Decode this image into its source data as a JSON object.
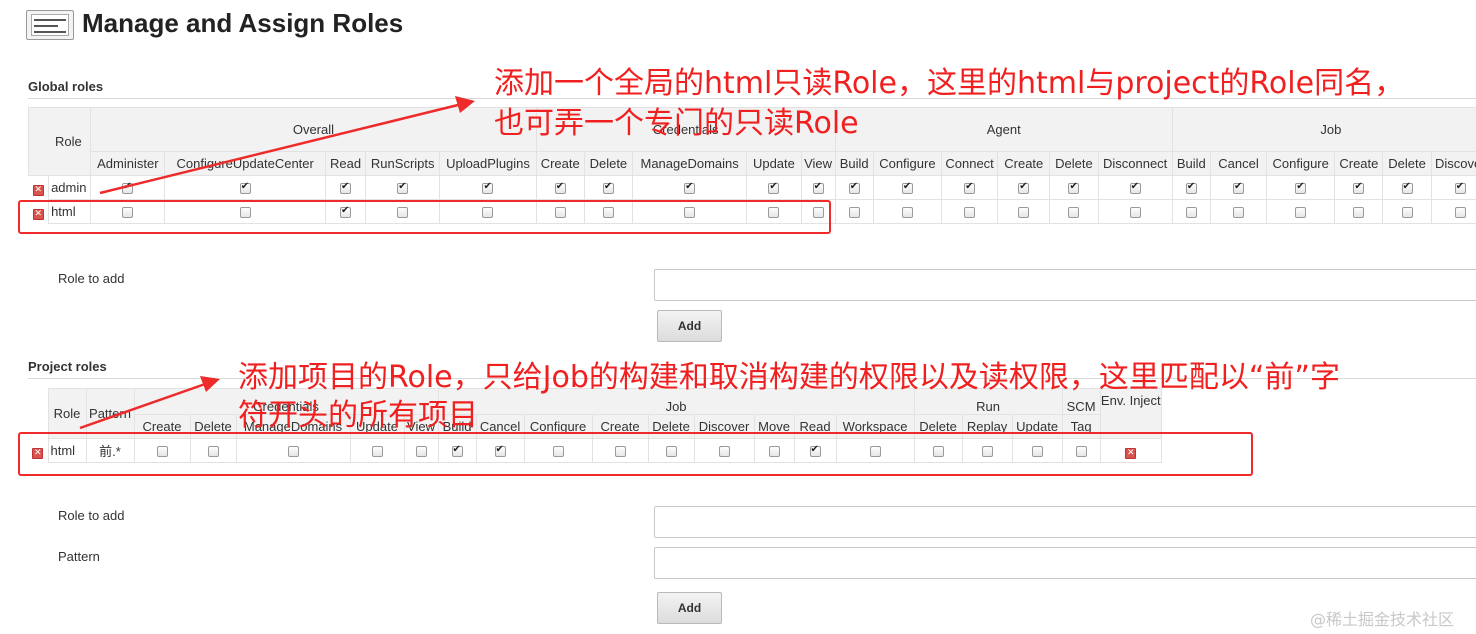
{
  "page": {
    "title": "Manage and Assign Roles",
    "icon": "user-card-icon"
  },
  "global_roles": {
    "section_title": "Global roles",
    "role_header": "Role",
    "groups": [
      "Overall",
      "Credentials",
      "Agent",
      "Job"
    ],
    "permissions": [
      "Administer",
      "ConfigureUpdateCenter",
      "Read",
      "RunScripts",
      "UploadPlugins",
      "Create",
      "Delete",
      "ManageDomains",
      "Update",
      "View",
      "Build",
      "Configure",
      "Connect",
      "Create",
      "Delete",
      "Disconnect",
      "Build",
      "Cancel",
      "Configure",
      "Create",
      "Delete",
      "Discover"
    ],
    "rows": [
      {
        "name": "admin",
        "checks": [
          true,
          true,
          true,
          true,
          true,
          true,
          true,
          true,
          true,
          true,
          true,
          true,
          true,
          true,
          true,
          true,
          true,
          true,
          true,
          true,
          true,
          true
        ]
      },
      {
        "name": "html",
        "checks": [
          false,
          false,
          true,
          false,
          false,
          false,
          false,
          false,
          false,
          false,
          false,
          false,
          false,
          false,
          false,
          false,
          false,
          false,
          false,
          false,
          false,
          false
        ]
      }
    ],
    "role_to_add_label": "Role to add",
    "add_button": "Add"
  },
  "project_roles": {
    "section_title": "Project roles",
    "role_header": "Role",
    "pattern_header": "Pattern",
    "groups": [
      "Credentials",
      "Job",
      "Run",
      "SCM",
      "Env. Inject"
    ],
    "permissions": [
      "Create",
      "Delete",
      "ManageDomains",
      "Update",
      "View",
      "Build",
      "Cancel",
      "Configure",
      "Create",
      "Delete",
      "Discover",
      "Move",
      "Read",
      "Workspace",
      "Delete",
      "Replay",
      "Update",
      "Tag"
    ],
    "rows": [
      {
        "name": "html",
        "pattern": "前.*",
        "checks": [
          false,
          false,
          false,
          false,
          false,
          true,
          true,
          false,
          false,
          false,
          false,
          false,
          true,
          false,
          false,
          false,
          false,
          false
        ]
      }
    ],
    "role_to_add_label": "Role to add",
    "pattern_label": "Pattern",
    "add_button": "Add"
  },
  "annotations": {
    "global_line1": "添加一个全局的html只读Role，这里的html与project的Role同名，",
    "global_line2": "也可弄一个专门的只读Role",
    "project_line1": "添加项目的Role，只给Job的构建和取消构建的权限以及读权限，这里匹配以“前”字",
    "project_line2": "符开头的所有项目",
    "color": "#f02020"
  },
  "watermark": "@稀土掘金技术社区"
}
